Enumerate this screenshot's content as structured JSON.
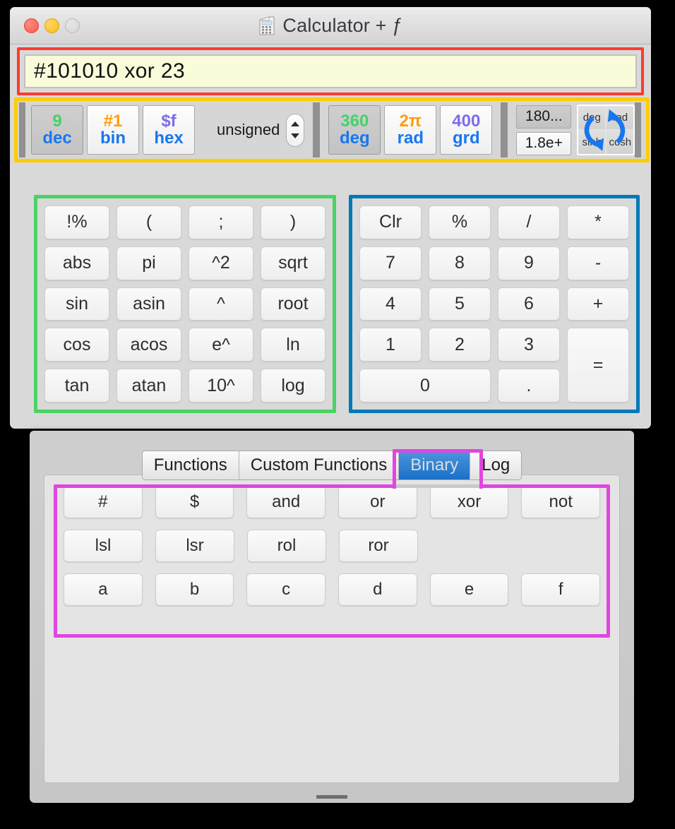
{
  "window": {
    "title": "Calculator + ƒ",
    "icon": "calculator-icon",
    "traffic_lights": {
      "close": "close-button",
      "minimize": "minimize-button",
      "zoom": "zoom-button"
    }
  },
  "expression": {
    "value": "#101010 xor 23",
    "placeholder": "",
    "annotation_color": "#FB3B30"
  },
  "toolbar": {
    "annotation_color": "#FFCC00",
    "base_modes": [
      {
        "symbol": "9",
        "label": "dec",
        "symbol_color": "#45D26A",
        "selected": true
      },
      {
        "symbol": "#1",
        "label": "bin",
        "symbol_color": "#FF9D0B",
        "selected": false
      },
      {
        "symbol": "$f",
        "label": "hex",
        "symbol_color": "#7D6CED",
        "selected": false
      }
    ],
    "sign_mode": {
      "value": "unsigned",
      "stepper": "stepper-control"
    },
    "angle_modes": [
      {
        "symbol": "360",
        "label": "deg",
        "symbol_color": "#45D26A",
        "selected": true
      },
      {
        "symbol": "2π",
        "label": "rad",
        "symbol_color": "#FF9D0B",
        "selected": false
      },
      {
        "symbol": "400",
        "label": "grd",
        "symbol_color": "#7D6CED",
        "selected": false
      }
    ],
    "notation_buttons": [
      {
        "label": "180...",
        "selected": true
      },
      {
        "label": "1.8e+",
        "selected": false
      }
    ],
    "hyperbolic_toggle": {
      "cells": [
        "deg",
        "rad",
        "sinh",
        "cosh"
      ],
      "icon": "circular-arrows-icon",
      "icon_color": "#1777EF"
    }
  },
  "function_pad": {
    "annotation_color": "#4AD363",
    "keys": [
      "!%",
      "(",
      ";",
      ")",
      "abs",
      "pi",
      "^2",
      "sqrt",
      "sin",
      "asin",
      "^",
      "root",
      "cos",
      "acos",
      "e^",
      "ln",
      "tan",
      "atan",
      "10^",
      "log"
    ]
  },
  "numeric_pad": {
    "annotation_color": "#0079B8",
    "keys": [
      {
        "label": "Clr",
        "span": ""
      },
      {
        "label": "%",
        "span": ""
      },
      {
        "label": "/",
        "span": ""
      },
      {
        "label": "*",
        "span": ""
      },
      {
        "label": "7",
        "span": ""
      },
      {
        "label": "8",
        "span": ""
      },
      {
        "label": "9",
        "span": ""
      },
      {
        "label": "-",
        "span": ""
      },
      {
        "label": "4",
        "span": ""
      },
      {
        "label": "5",
        "span": ""
      },
      {
        "label": "6",
        "span": ""
      },
      {
        "label": "+",
        "span": ""
      },
      {
        "label": "1",
        "span": ""
      },
      {
        "label": "2",
        "span": ""
      },
      {
        "label": "3",
        "span": ""
      },
      {
        "label": "=",
        "span": "eq"
      },
      {
        "label": "0",
        "span": "zero"
      },
      {
        "label": ".",
        "span": ""
      }
    ]
  },
  "panel": {
    "annotation_color": "#E046E0",
    "tabs": [
      {
        "label": "Functions",
        "active": false
      },
      {
        "label": "Custom Functions",
        "active": false
      },
      {
        "label": "Binary",
        "active": true
      },
      {
        "label": "Log",
        "active": false
      }
    ],
    "binary_rows": [
      [
        "#",
        "$",
        "and",
        "or",
        "xor",
        "not"
      ],
      [
        "lsl",
        "lsr",
        "rol",
        "ror"
      ],
      [
        "a",
        "b",
        "c",
        "d",
        "e",
        "f"
      ]
    ],
    "grabber": "resize-grabber"
  }
}
